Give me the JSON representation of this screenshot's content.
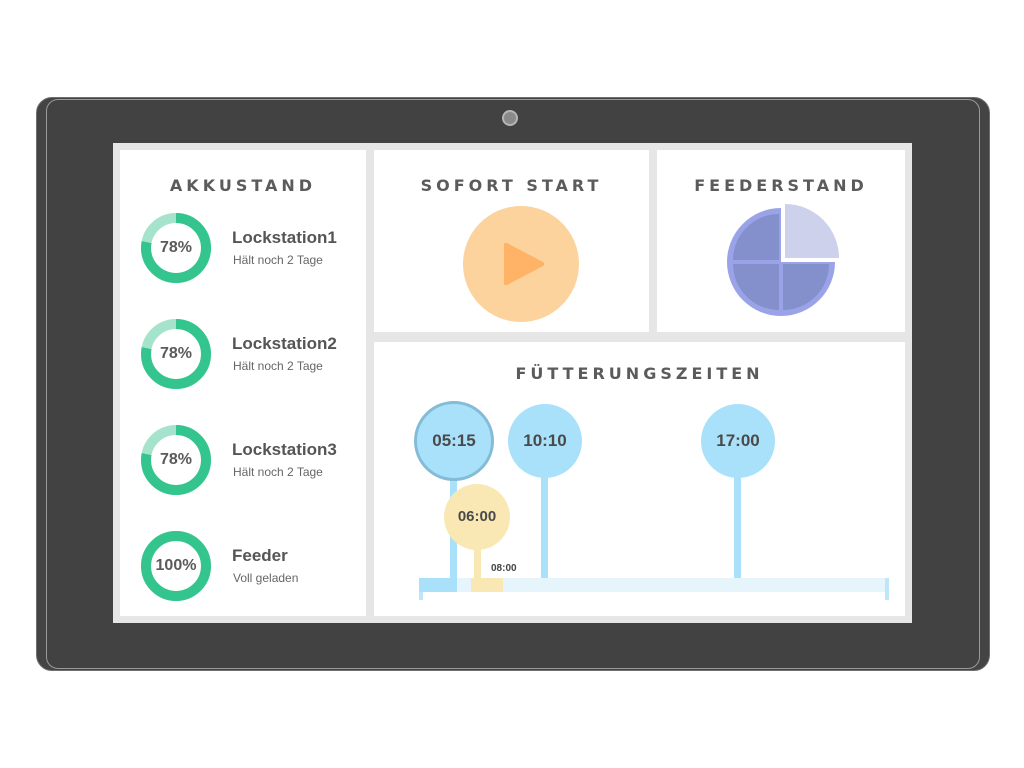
{
  "colors": {
    "ring_green": "#34c58e",
    "ring_light": "#a6e3cc",
    "play_bg": "#fcd29d",
    "play_icon": "#ffb366",
    "pie_dark": "#8490cc",
    "pie_light": "#cdd1eb",
    "pie_rim": "#9aa3e8",
    "time_blue": "#a9e1fb",
    "time_yellow": "#f9e8b4"
  },
  "akkustand": {
    "title": "AKKUSTAND",
    "items": [
      {
        "label": "78%",
        "name": "Lockstation1",
        "sub": "Hält noch 2 Tage",
        "percent": 78
      },
      {
        "label": "78%",
        "name": "Lockstation2",
        "sub": "Hält noch 2 Tage",
        "percent": 78
      },
      {
        "label": "78%",
        "name": "Lockstation3",
        "sub": "Hält noch 2 Tage",
        "percent": 78
      },
      {
        "label": "100%",
        "name": "Feeder",
        "sub": "Voll geladen",
        "percent": 100
      }
    ]
  },
  "sofort_start": {
    "title": "SOFORT START",
    "icon": "play-icon"
  },
  "feederstand": {
    "title": "FEEDERSTAND",
    "icon": "pie-chart-icon"
  },
  "fuetterungszeiten": {
    "title": "FÜTTERUNGSZEITEN",
    "times": [
      {
        "label": "05:15",
        "kind": "blue",
        "selected": true
      },
      {
        "label": "06:00",
        "kind": "yellow",
        "selected": false
      },
      {
        "label": "10:10",
        "kind": "blue",
        "selected": false
      },
      {
        "label": "17:00",
        "kind": "blue",
        "selected": false
      }
    ],
    "marker_label": "08:00"
  }
}
